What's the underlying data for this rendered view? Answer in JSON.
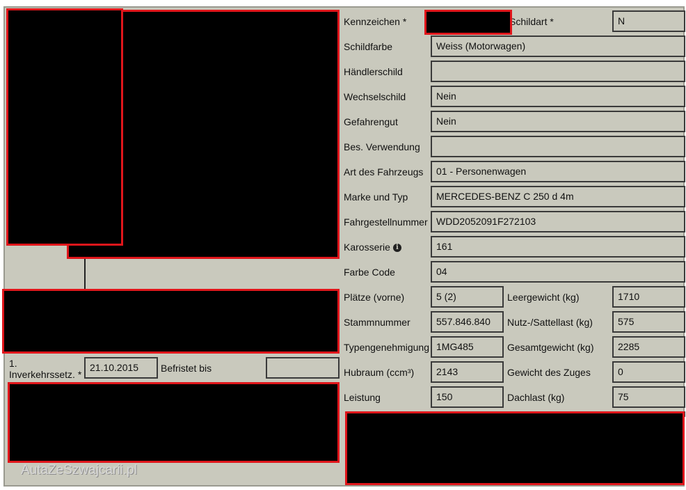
{
  "form": {
    "kennzeichen_label": "Kennzeichen *",
    "schildart_label": "Schildart *",
    "schildart_value": "N",
    "rows": [
      {
        "label": "Schildfarbe",
        "value": "Weiss (Motorwagen)"
      },
      {
        "label": "Händlerschild",
        "value": ""
      },
      {
        "label": "Wechselschild",
        "value": "Nein"
      },
      {
        "label": "Gefahrengut",
        "value": "Nein"
      },
      {
        "label": "Bes. Verwendung",
        "value": ""
      },
      {
        "label": "Art des Fahrzeugs",
        "value": "01 - Personenwagen"
      },
      {
        "label": "Marke und Typ",
        "value": "MERCEDES-BENZ C 250 d 4m"
      },
      {
        "label": "Fahrgestellnummer",
        "value": "WDD2052091F272103"
      },
      {
        "label": "Karosserie",
        "value": "161"
      },
      {
        "label": "Farbe Code",
        "value": "04"
      }
    ],
    "pairs": [
      {
        "label1": "Plätze (vorne)",
        "value1": "5 (2)",
        "label2": "Leergewicht (kg)",
        "value2": "1710"
      },
      {
        "label1": "Stammnummer",
        "value1": "557.846.840",
        "label2": "Nutz-/Sattellast (kg)",
        "value2": "575"
      },
      {
        "label1": "Typengenehmigung",
        "value1": "1MG485",
        "label2": "Gesamtgewicht (kg)",
        "value2": "2285"
      },
      {
        "label1": "Hubraum (ccm³)",
        "value1": "2143",
        "label2": "Gewicht des Zuges",
        "value2": "0"
      },
      {
        "label1": "Leistung",
        "value1": "150",
        "label2": "Dachlast (kg)",
        "value2": "75"
      }
    ],
    "inverkehrs_label_1": "1.",
    "inverkehrs_label_2": "Inverkehrssetz. *",
    "inverkehrs_value": "21.10.2015",
    "befristet_label": "Befristet bis",
    "befristet_value": ""
  },
  "icons": {
    "karosserie_info": "info-icon"
  },
  "watermark": "AutaZeSzwajcarii.pl"
}
